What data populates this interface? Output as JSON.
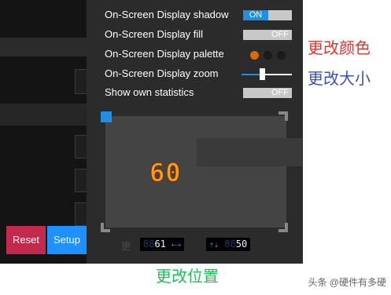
{
  "settings": {
    "shadow": {
      "label": "On-Screen Display shadow",
      "state": "ON"
    },
    "fill": {
      "label": "On-Screen Display fill",
      "state": "OFF"
    },
    "palette": {
      "label": "On-Screen Display palette",
      "colors": [
        "#d96b00",
        "#1a1a1a",
        "#1a1a1a"
      ],
      "selected": 0
    },
    "zoom": {
      "label": "On-Screen Display zoom",
      "level": 0.4
    },
    "statistics": {
      "label": "Show own statistics",
      "state": "OFF"
    }
  },
  "preview": {
    "fps": "60",
    "left_readout": {
      "dim": "88",
      "value": "61",
      "arrows": "⇠⇢"
    },
    "right_readout": {
      "arrows": "⇡⇣",
      "dim": "88",
      "value": "50"
    },
    "hidden_label": "更"
  },
  "buttons": {
    "reset": "Reset",
    "setup": "Setup"
  },
  "annotations": {
    "change_color": "更改颜色",
    "change_size": "更改大小",
    "change_position": "更改位置"
  },
  "watermark": "头条 @硬件有多硬",
  "colors": {
    "accent": "#1f8fe6",
    "reset": "#c2294a",
    "fps": "#ff9a1a"
  }
}
